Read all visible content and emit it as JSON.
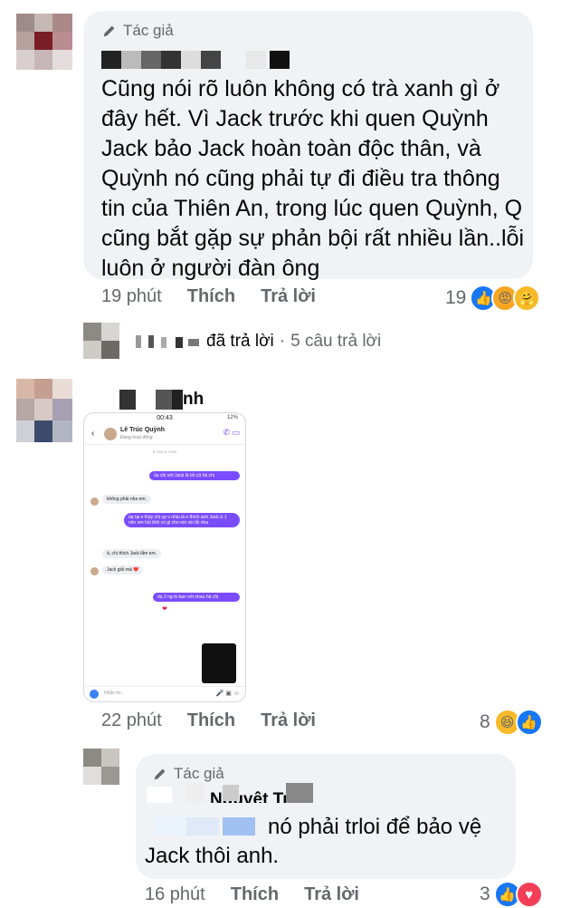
{
  "comments": {
    "c1": {
      "author_badge": "Tác giả",
      "text": "Cũng nói rõ luôn không có trà xanh gì ở đây hết. Vì Jack trước khi quen Quỳnh Jack bảo Jack hoàn toàn độc thân, và Quỳnh nó cũng phải tự đi điều tra thông tin của Thiên An, trong lúc quen Quỳnh, Q cũng bắt gặp sự phản bội rất nhiều lần..lỗi luôn ở người đàn ông",
      "time": "19 phút",
      "like_label": "Thích",
      "reply_label": "Trả lời",
      "reaction_count": "19",
      "reactions": [
        "like-icon",
        "angry-icon",
        "care-icon"
      ]
    },
    "replies_summary": {
      "action": "đã trả lời",
      "dot": "·",
      "count": "5 câu trả lời"
    },
    "c2": {
      "name_fragment": "nh",
      "time": "22 phút",
      "like_label": "Thích",
      "reply_label": "Trả lời",
      "reaction_count": "8",
      "reactions": [
        "haha-icon",
        "like-icon"
      ]
    },
    "c3": {
      "author_badge": "Tác giả",
      "name_partial": "Nguyệt Trâm",
      "text_line1": "nó phải trloi để bảo vệ",
      "text_line2": "Jack thôi anh.",
      "time": "16 phút",
      "like_label": "Thích",
      "reply_label": "Trả lời",
      "reaction_count": "3",
      "reactions": [
        "like-icon",
        "love-icon"
      ]
    }
  },
  "phone": {
    "time": "00:43",
    "battery": "12%",
    "contact_name": "Lê Trúc Quỳnh",
    "contact_status": "Đang hoạt động",
    "timestamp1": "8 THG 6, 2020",
    "msg1": "ủa chị với Jack là bồ cũ hả chị",
    "msg2": "không phải nha em.",
    "msg3": "dạ tại e thấy chị up v nhiu là e thích anh Jack á :( nên em hỏi thôi có gì cho em xin lỗi nha",
    "msg4": "à, chị thích Jack lắm em.",
    "msg5": "Jack giỏi mà ❤️",
    "msg6": "dạ 2 ng là bạn với nhau hả chị",
    "heart": "❤",
    "placeholder": "Nhắn tin..."
  }
}
